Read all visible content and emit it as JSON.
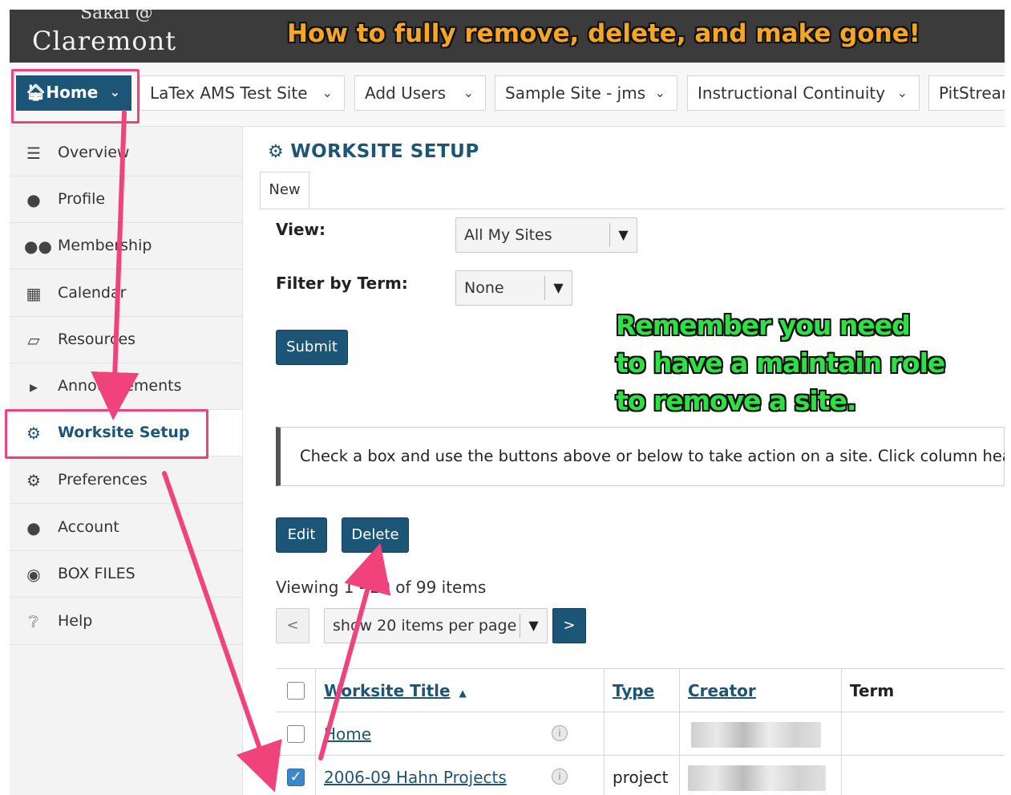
{
  "header": {
    "logo_top": "Sakai @",
    "logo_main": "Claremont",
    "banner": "How to fully remove, delete, and make gone!"
  },
  "site_tabs": [
    {
      "label": "Home",
      "icon": "home-icon"
    },
    {
      "label": "LaTex AMS Test Site"
    },
    {
      "label": "Add Users"
    },
    {
      "label": "Sample Site - jms"
    },
    {
      "label": "Instructional Continuity"
    },
    {
      "label": "PitStrear"
    }
  ],
  "sidebar": {
    "items": [
      {
        "label": "Overview",
        "icon": "list-icon"
      },
      {
        "label": "Profile",
        "icon": "user-icon"
      },
      {
        "label": "Membership",
        "icon": "group-icon"
      },
      {
        "label": "Calendar",
        "icon": "calendar-icon"
      },
      {
        "label": "Resources",
        "icon": "folder-icon"
      },
      {
        "label": "Announcements",
        "icon": "megaphone-icon"
      },
      {
        "label": "Worksite Setup",
        "icon": "gears-icon",
        "active": true
      },
      {
        "label": "Preferences",
        "icon": "gear-icon"
      },
      {
        "label": "Account",
        "icon": "user-icon"
      },
      {
        "label": "BOX FILES",
        "icon": "globe-icon"
      },
      {
        "label": "Help",
        "icon": "question-icon"
      }
    ]
  },
  "main": {
    "title": "WORKSITE SETUP",
    "tab_new": "New",
    "view_label": "View:",
    "view_value": "All My Sites",
    "term_label": "Filter by Term:",
    "term_value": "None",
    "submit": "Submit",
    "callout": [
      "Remember you need",
      "to have a maintain role",
      "to remove a site."
    ],
    "instructions": "Check a box and use the buttons above or below to take action on a site. Click column heade",
    "edit": "Edit",
    "delete": "Delete",
    "viewing": "Viewing 1 - 20 of 99 items",
    "prev": "<",
    "per_page": "show 20 items per page",
    "next": ">"
  },
  "table": {
    "headers": [
      "Worksite Title",
      "Type",
      "Creator",
      "Term"
    ],
    "sort_glyph": "▲",
    "rows": [
      {
        "title": "Home",
        "type": "",
        "checked": false
      },
      {
        "title": "2006-09 Hahn Projects",
        "type": "project",
        "checked": true
      }
    ]
  },
  "colors": {
    "primary": "#1d5577",
    "highlight": "#f0437b",
    "banner_text": "#f5a623",
    "callout_text": "#2ee043"
  }
}
